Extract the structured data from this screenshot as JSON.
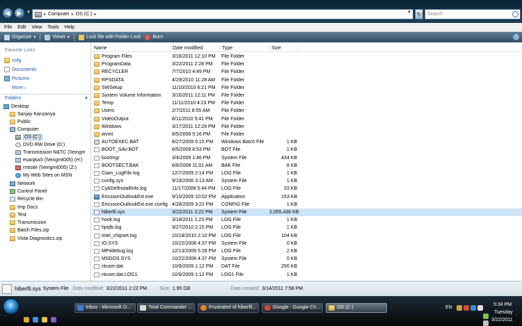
{
  "address": {
    "segments": [
      "Computer",
      "OS (C:)"
    ],
    "search_placeholder": "Search"
  },
  "menu": [
    "File",
    "Edit",
    "View",
    "Tools",
    "Help"
  ],
  "toolbar": {
    "organize": "Organize",
    "views": "Views",
    "lock": "Lock file with Folder Lock",
    "burn": "Burn"
  },
  "sidebar": {
    "favorites_header": "Favorite Links",
    "favorites": [
      "cnfg",
      "Documents",
      "Pictures"
    ],
    "more": "More",
    "folders_header": "Folders",
    "tree": [
      "Desktop",
      "Sanjay Kanzariya",
      "Public",
      "Computer",
      "OS (C:)",
      "DVD RW Drive (D:)",
      "Transmission N&TC (\\\\eingm",
      "esanjkaS (\\\\eingmt005) (H:)",
      "rmtsite (\\\\eingmt005) (Z:)",
      "My Web Sites on MSN",
      "Network",
      "Control Panel",
      "Recycle Bin",
      "Imp Docs",
      "Test",
      "Transmission",
      "Batch Files.zip",
      "Vista Diagnostics.zip"
    ]
  },
  "columns": {
    "name": "Name",
    "date": "Date modified",
    "type": "Type",
    "size": "Size"
  },
  "files": [
    {
      "name": "Program Files",
      "date": "3/16/2011 12:10 PM",
      "type": "File Folder",
      "size": "",
      "icon": "folder"
    },
    {
      "name": "ProgramData",
      "date": "3/22/2011 2:28 PM",
      "type": "File Folder",
      "size": "",
      "icon": "folder"
    },
    {
      "name": "RECYCLER",
      "date": "7/7/2010 4:49 PM",
      "type": "File Folder",
      "size": "",
      "icon": "folder"
    },
    {
      "name": "RPSDATA",
      "date": "4/29/2010 11:28 AM",
      "type": "File Folder",
      "size": "",
      "icon": "folder"
    },
    {
      "name": "SWSetup",
      "date": "11/10/2010 6:21 PM",
      "type": "File Folder",
      "size": "",
      "icon": "folder"
    },
    {
      "name": "System Volume Information",
      "date": "3/16/2011 12:11 PM",
      "type": "File Folder",
      "size": "",
      "icon": "folder"
    },
    {
      "name": "Temp",
      "date": "11/11/2010 4:23 PM",
      "type": "File Folder",
      "size": "",
      "icon": "folder"
    },
    {
      "name": "Users",
      "date": "2/7/2011 8:55 AM",
      "type": "File Folder",
      "size": "",
      "icon": "folder"
    },
    {
      "name": "VideoOutput",
      "date": "8/11/2010 5:41 PM",
      "type": "File Folder",
      "size": "",
      "icon": "folder"
    },
    {
      "name": "Windows",
      "date": "3/17/2011 12:28 PM",
      "type": "File Folder",
      "size": "",
      "icon": "folder"
    },
    {
      "name": "wvmt",
      "date": "8/5/2008 5:16 PM",
      "type": "File Folder",
      "size": "",
      "icon": "folder"
    },
    {
      "name": "AUTOEXEC.BAT",
      "date": "8/27/2009 5:15 PM",
      "type": "Windows Batch File",
      "size": "1 KB",
      "icon": "gear"
    },
    {
      "name": "BOOT_SAV.BOT",
      "date": "8/5/2009 8:53 PM",
      "type": "BOT File",
      "size": "1 KB",
      "icon": "file"
    },
    {
      "name": "bootmgr",
      "date": "3/4/2009 1:46 PM",
      "type": "System File",
      "size": "434 KB",
      "icon": "file"
    },
    {
      "name": "BOOTSECT.BAK",
      "date": "8/6/2008 11:01 AM",
      "type": "BAK File",
      "size": "8 KB",
      "icon": "file"
    },
    {
      "name": "Ciam_LogFile.log",
      "date": "12/7/2009 2:14 PM",
      "type": "LOG File",
      "size": "1 KB",
      "icon": "file"
    },
    {
      "name": "config.sys",
      "date": "9/19/2006 3:13 AM",
      "type": "System File",
      "size": "1 KB",
      "icon": "file"
    },
    {
      "name": "CybDefInstallInfo.log",
      "date": "11/17/2008 5:44 PM",
      "type": "LOG File",
      "size": "33 KB",
      "icon": "file"
    },
    {
      "name": "EricssonOutlookExt.exe",
      "date": "9/10/2009 10:02 PM",
      "type": "Application",
      "size": "153 KB",
      "icon": "exe"
    },
    {
      "name": "EricssonOutlookExt.exe.config",
      "date": "4/28/2009 3:22 PM",
      "type": "CONFIG File",
      "size": "1 KB",
      "icon": "file"
    },
    {
      "name": "hiberfil.sys",
      "date": "3/22/2011 2:22 PM",
      "type": "System File",
      "size": "2,055,436 KB",
      "icon": "file",
      "selected": true
    },
    {
      "name": "hook.log",
      "date": "3/18/2011 1:23 PM",
      "type": "LOG File",
      "size": "1 KB",
      "icon": "file"
    },
    {
      "name": "hpqlb.log",
      "date": "9/27/2010 2:15 PM",
      "type": "LOG File",
      "size": "1 KB",
      "icon": "file"
    },
    {
      "name": "intel_chipset.log",
      "date": "10/18/2010 2:10 PM",
      "type": "LOG File",
      "size": "104 KB",
      "icon": "file"
    },
    {
      "name": "IO.SYS",
      "date": "10/22/2008 4:37 PM",
      "type": "System File",
      "size": "0 KB",
      "icon": "file"
    },
    {
      "name": "MP4debug.log",
      "date": "12/13/2009 5:28 PM",
      "type": "LOG File",
      "size": "2 KB",
      "icon": "file"
    },
    {
      "name": "MSDOS.SYS",
      "date": "10/22/2008 4:37 PM",
      "type": "System File",
      "size": "0 KB",
      "icon": "file"
    },
    {
      "name": "ntuser.dat",
      "date": "10/9/2009 1:12 PM",
      "type": "DAT File",
      "size": "256 KB",
      "icon": "file"
    },
    {
      "name": "ntuser.dat.LOG1",
      "date": "10/9/2009 1:12 PM",
      "type": "LOG1 File",
      "size": "1 KB",
      "icon": "file"
    }
  ],
  "details": {
    "name": "hiberfil.sys",
    "type": "System File",
    "date_modified_label": "Date modified:",
    "date_modified": "3/22/2011 2:22 PM",
    "size_label": "Size:",
    "size": "1.95 GB",
    "date_created_label": "Date created:",
    "date_created": "3/14/2011 7:58 PM"
  },
  "taskbar": {
    "buttons": [
      "Inbox - Microsoft O...",
      "Total Commander ...",
      "Frustrated of hiberfil...",
      "Google - Google Ch...",
      "OS (C:)"
    ],
    "lang": "EN",
    "time": "5:34 PM",
    "day": "Tuesday",
    "date": "3/22/2011"
  }
}
